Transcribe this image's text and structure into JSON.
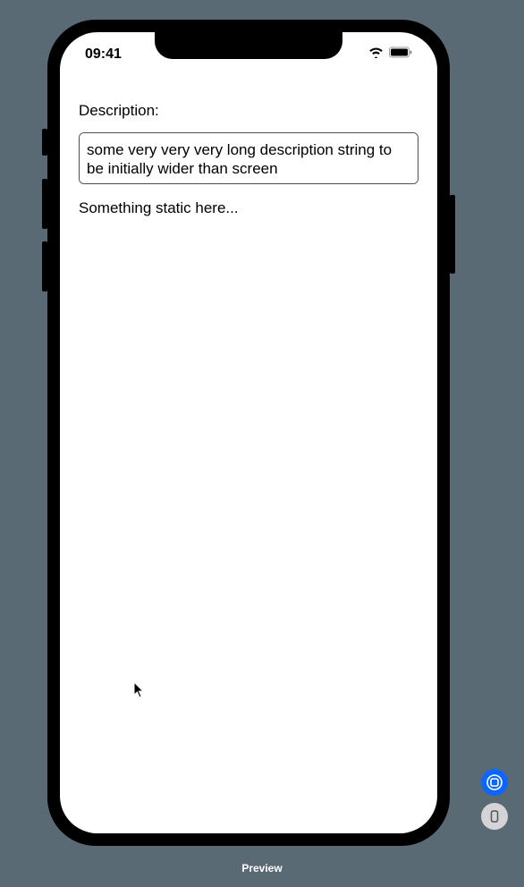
{
  "status_bar": {
    "time": "09:41"
  },
  "content": {
    "description_label": "Description:",
    "description_value": "some very very very long description string to be initially wider than screen",
    "static_text": "Something static here..."
  },
  "footer": {
    "preview_label": "Preview"
  }
}
